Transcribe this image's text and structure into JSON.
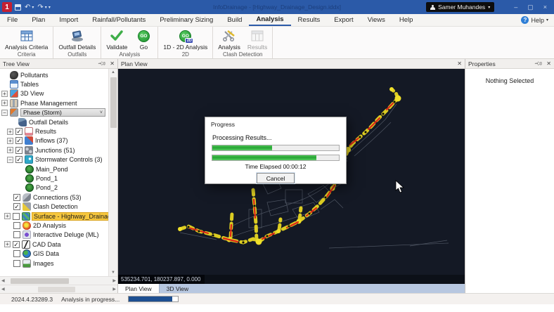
{
  "titlebar": {
    "title": "InfoDrainage - [Highway_Drainage_Design.iddx]",
    "user": "Samer Muhandes"
  },
  "menubar": {
    "tabs": [
      "File",
      "Plan",
      "Import",
      "Rainfall/Pollutants",
      "Preliminary Sizing",
      "Build",
      "Analysis",
      "Results",
      "Export",
      "Views",
      "Help"
    ],
    "active_tab": "Analysis",
    "help_label": "Help"
  },
  "ribbon": {
    "groups": [
      {
        "label": "Criteria",
        "buttons": [
          {
            "label": "Analysis Criteria",
            "icon": "criteria"
          }
        ]
      },
      {
        "label": "Outfalls",
        "buttons": [
          {
            "label": "Outfall Details",
            "icon": "outfall"
          }
        ]
      },
      {
        "label": "Analysis",
        "buttons": [
          {
            "label": "Validate",
            "icon": "validate"
          },
          {
            "label": "Go",
            "icon": "go"
          }
        ]
      },
      {
        "label": "2D",
        "buttons": [
          {
            "label": "1D - 2D Analysis",
            "icon": "go2d"
          }
        ]
      },
      {
        "label": "Clash Detection",
        "buttons": [
          {
            "label": "Analysis",
            "icon": "clash"
          },
          {
            "label": "Results",
            "icon": "clashresults",
            "disabled": true
          }
        ]
      }
    ],
    "go_text": "GO",
    "badge_2d": "2D"
  },
  "tree": {
    "title": "Tree View",
    "items": [
      {
        "label": "Pollutants",
        "indent": 14,
        "icon": "pollutants"
      },
      {
        "label": "Tables",
        "indent": 14,
        "icon": "tables"
      },
      {
        "label": "3D View",
        "indent": 2,
        "expander": "plus",
        "icon": "view3d"
      },
      {
        "label": "Phase Management",
        "indent": 2,
        "expander": "plus",
        "icon": "phasemgmt"
      },
      {
        "label": "Phase (Storm)",
        "indent": 2,
        "expander": "minus",
        "icon": "phase",
        "combo": true
      },
      {
        "label": "Outfall Details",
        "indent": 26,
        "icon": "outfall"
      },
      {
        "label": "Results",
        "indent": 10,
        "expander": "plus",
        "checked": true,
        "icon": "results"
      },
      {
        "label": "Inflows (37)",
        "indent": 10,
        "expander": "plus",
        "checked": true,
        "icon": "inflows"
      },
      {
        "label": "Junctions (51)",
        "indent": 10,
        "expander": "plus",
        "checked": true,
        "icon": "junctions"
      },
      {
        "label": "Stormwater Controls (3)",
        "indent": 10,
        "expander": "minus",
        "checked": true,
        "icon": "swc"
      },
      {
        "label": "Main_Pond",
        "indent": 36,
        "icon": "pond"
      },
      {
        "label": "Pond_1",
        "indent": 36,
        "icon": "pond"
      },
      {
        "label": "Pond_2",
        "indent": 36,
        "icon": "pond"
      },
      {
        "label": "Connections (53)",
        "indent": 19,
        "checked": true,
        "icon": "connections"
      },
      {
        "label": "Clash Detection",
        "indent": 19,
        "checked": true,
        "icon": "clash"
      },
      {
        "label": "Surface - Highway_Drainage_Design_Phase.id",
        "indent": 6,
        "expander": "plus",
        "checked": false,
        "icon": "surface",
        "highlight": true
      },
      {
        "label": "2D Analysis",
        "indent": 19,
        "checked": false,
        "icon": "analysis2d"
      },
      {
        "label": "Interactive Deluge (ML)",
        "indent": 19,
        "checked": false,
        "icon": "deluge"
      },
      {
        "label": "CAD Data",
        "indent": 6,
        "expander": "plus",
        "checked": true,
        "icon": "cad"
      },
      {
        "label": "GIS Data",
        "indent": 19,
        "checked": false,
        "icon": "gis"
      },
      {
        "label": "Images",
        "indent": 19,
        "checked": false,
        "icon": "images"
      }
    ]
  },
  "plan": {
    "title": "Plan View",
    "coords": "535234.701, 180237.897, 0.000",
    "tabs": [
      "Plan View",
      "3D View"
    ],
    "active_tab": "Plan View"
  },
  "properties": {
    "title": "Properties",
    "empty_text": "Nothing Selected"
  },
  "dialog": {
    "title": "Progress",
    "message": "Processing Results...",
    "bar1_percent": 47,
    "bar2_percent": 82,
    "elapsed": "Time Elapsed 00:00:12",
    "cancel_label": "Cancel"
  },
  "statusbar": {
    "version": "2024.4.23289.3",
    "status": "Analysis in progress...",
    "progress_percent": 88
  }
}
